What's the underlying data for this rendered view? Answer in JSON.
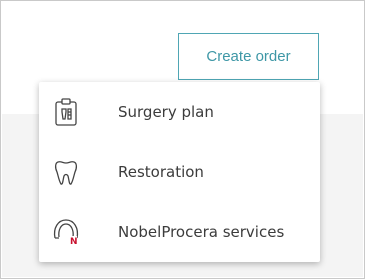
{
  "create_order": {
    "label": "Create order"
  },
  "menu": {
    "items": [
      {
        "label": "Surgery plan",
        "icon": "surgery-plan-icon"
      },
      {
        "label": "Restoration",
        "icon": "tooth-icon"
      },
      {
        "label": "NobelProcera services",
        "icon": "nobelprocera-icon",
        "badge": "N"
      }
    ]
  },
  "colors": {
    "accent": "#3e97a6",
    "badge": "#c8102e",
    "text": "#3c3c3c",
    "background_band": "#f4f4f4"
  }
}
